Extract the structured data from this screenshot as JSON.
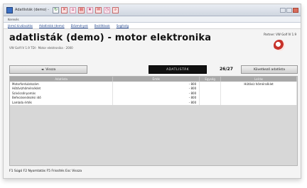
{
  "window": {
    "title": "Adatlisták (demo) - Mo...",
    "address": "Keresés"
  },
  "nav": {
    "links": [
      "Jármű kiválasztás",
      "Adatlisták (demo)",
      "Előzmények",
      "Beállítások",
      "Segítség"
    ]
  },
  "page": {
    "title": "adatlisták (demo) - motor elektronika",
    "subtitle": "VW Golf IV 1.9 TDI · Motor elektronika · 2000",
    "right_text": "Partner: VW Golf IV 1.9",
    "logo_icon": "brand-logo-icon"
  },
  "toolbar": {
    "back_label": "Vissza",
    "dark_label": "ADATLISTÁK",
    "count": "26/27",
    "right_label": "Következő adatlista"
  },
  "table": {
    "columns": [
      "Adatlista",
      "Érték",
      "Egység",
      "Leírás"
    ],
    "rows": [
      {
        "name": "Motorfordulatszám",
        "value": "- 800",
        "unit": "",
        "note": "Hűtővíz hőmérséklet"
      },
      {
        "name": "Hűtővízhőmérséklet",
        "value": "- 800",
        "unit": "",
        "note": ""
      },
      {
        "name": "Szívócsőnyomás",
        "value": "- 800",
        "unit": "",
        "note": ""
      },
      {
        "name": "Befecskendezési idő",
        "value": "- 800",
        "unit": "",
        "note": ""
      },
      {
        "name": "Lambda érték",
        "value": "- 800",
        "unit": "",
        "note": ""
      }
    ]
  },
  "footer": {
    "note": "F1 Súgó   F2 Nyomtatás   F5 Frissítés   Esc Vissza"
  }
}
